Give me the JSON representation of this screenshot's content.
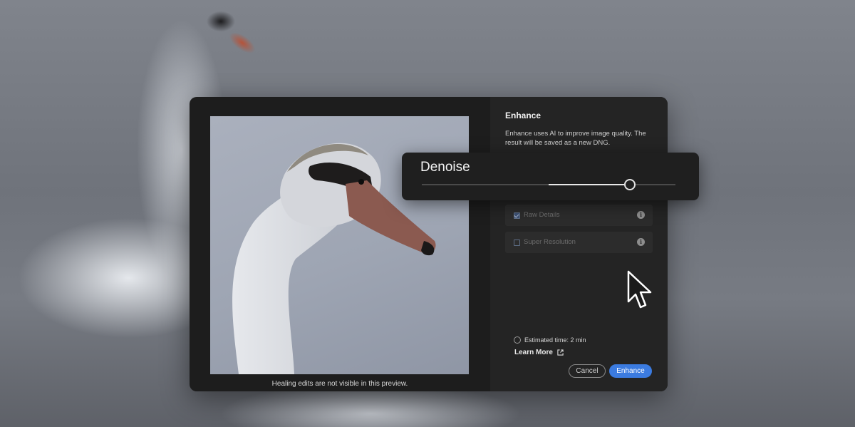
{
  "dialog": {
    "preview_caption": "Healing edits are not visible in this preview.",
    "panel": {
      "title": "Enhance",
      "description": "Enhance uses AI to improve image quality. The result will be saved as a new DNG.",
      "options": [
        {
          "label": "Raw Details",
          "checked": true,
          "icon": "info-icon"
        },
        {
          "label": "Super Resolution",
          "checked": false,
          "icon": "info-icon"
        }
      ],
      "estimated_time": "Estimated time: 2 min",
      "learn_more": "Learn More",
      "cancel_label": "Cancel",
      "enhance_label": "Enhance"
    }
  },
  "denoise": {
    "label": "Denoise",
    "range_start": 0.5,
    "value": 0.82
  },
  "colors": {
    "accent": "#3b7be0",
    "dialog_bg": "#1d1d1d",
    "panel_bg": "#242424"
  }
}
